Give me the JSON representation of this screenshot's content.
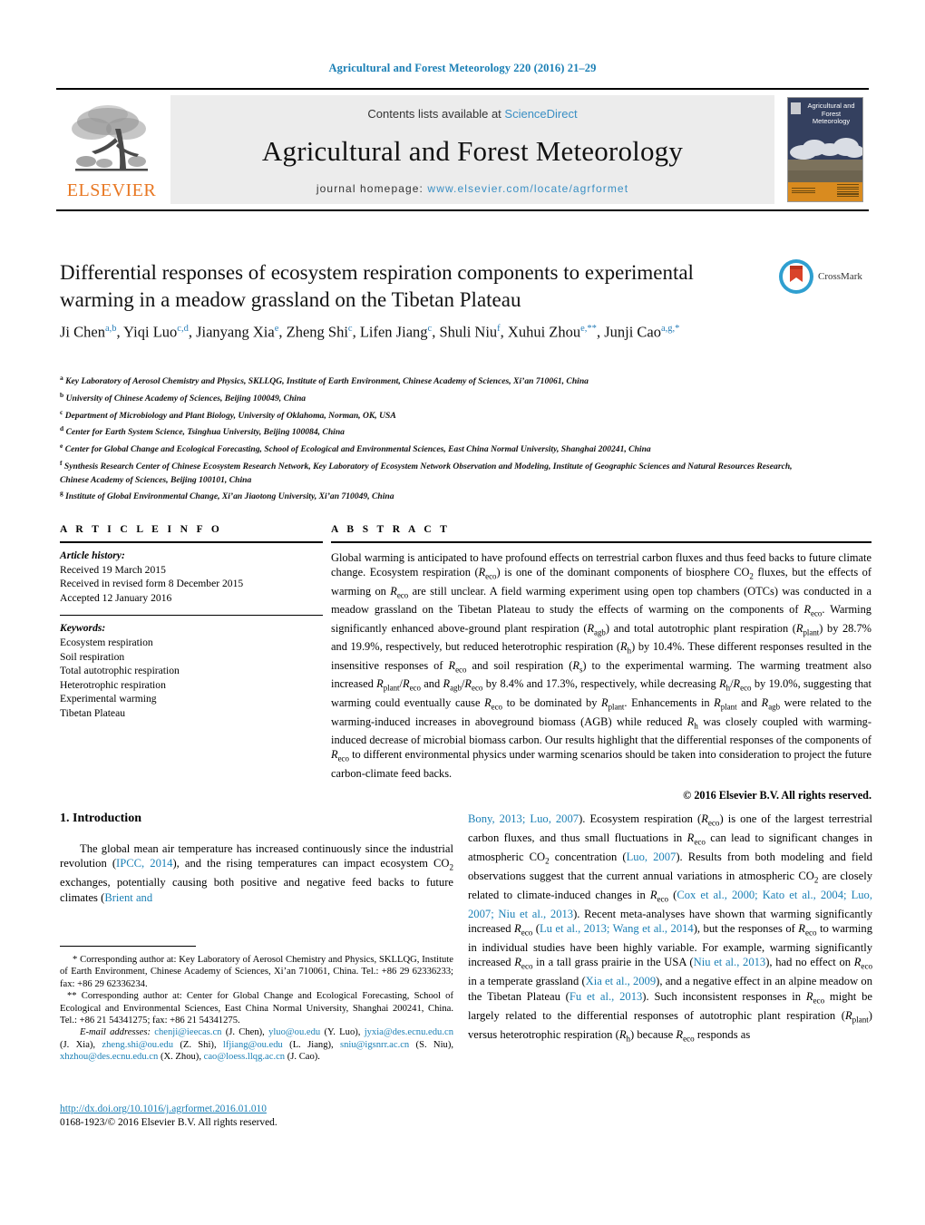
{
  "running_head": "Agricultural and Forest Meteorology 220 (2016) 21–29",
  "masthead": {
    "publisher": "ELSEVIER",
    "contents_prefix": "Contents lists available at ",
    "contents_link": "ScienceDirect",
    "journal_title": "Agricultural and Forest Meteorology",
    "homepage_prefix": "journal homepage: ",
    "homepage_url": "www.elsevier.com/locate/agrformet",
    "cover_title": "Agricultural and Forest Meteorology"
  },
  "article": {
    "title": "Differential responses of ecosystem respiration components to experimental warming in a meadow grassland on the Tibetan Plateau",
    "crossmark_label": "CrossMark",
    "authors_html": "Ji Chen<sup>a,b</sup>, Yiqi Luo<sup>c,d</sup>, Jianyang Xia<sup>e</sup>, Zheng Shi<sup>c</sup>, Lifen Jiang<sup>c</sup>, Shuli Niu<sup>f</sup>, Xuhui Zhou<sup>e,**</sup>, Junji Cao<sup>a,g,*</sup>",
    "affiliations": [
      {
        "mark": "a",
        "text": "Key Laboratory of Aerosol Chemistry and Physics, SKLLQG, Institute of Earth Environment, Chinese Academy of Sciences, Xi’an 710061, China"
      },
      {
        "mark": "b",
        "text": "University of Chinese Academy of Sciences, Beijing 100049, China"
      },
      {
        "mark": "c",
        "text": "Department of Microbiology and Plant Biology, University of Oklahoma, Norman, OK, USA"
      },
      {
        "mark": "d",
        "text": "Center for Earth System Science, Tsinghua University, Beijing 100084, China"
      },
      {
        "mark": "e",
        "text": "Center for Global Change and Ecological Forecasting, School of Ecological and Environmental Sciences, East China Normal University, Shanghai 200241, China"
      },
      {
        "mark": "f",
        "text": "Synthesis Research Center of Chinese Ecosystem Research Network, Key Laboratory of Ecosystem Network Observation and Modeling, Institute of Geographic Sciences and Natural Resources Research, Chinese Academy of Sciences, Beijing 100101, China"
      },
      {
        "mark": "g",
        "text": "Institute of Global Environmental Change, Xi’an Jiaotong University, Xi’an 710049, China"
      }
    ]
  },
  "info": {
    "heading": "A R T I C L E   I N F O",
    "history_label": "Article history:",
    "history": [
      "Received 19 March 2015",
      "Received in revised form 8 December 2015",
      "Accepted 12 January 2016"
    ],
    "keywords_label": "Keywords:",
    "keywords": [
      "Ecosystem respiration",
      "Soil respiration",
      "Total autotrophic respiration",
      "Heterotrophic respiration",
      "Experimental warming",
      "Tibetan Plateau"
    ]
  },
  "abstract": {
    "heading": "A B S T R A C T",
    "text_html": "Global warming is anticipated to have profound effects on terrestrial carbon fluxes and thus feed backs to future climate change. Ecosystem respiration (<i>R</i><sub>eco</sub>) is one of the dominant components of biosphere CO<sub>2</sub> fluxes, but the effects of warming on <i>R</i><sub>eco</sub> are still unclear. A field warming experiment using open top chambers (OTCs) was conducted in a meadow grassland on the Tibetan Plateau to study the effects of warming on the components of <i>R</i><sub>eco</sub>. Warming significantly enhanced above-ground plant respiration (<i>R</i><sub>agb</sub>) and total autotrophic plant respiration (<i>R</i><sub>plant</sub>) by 28.7% and 19.9%, respectively, but reduced heterotrophic respiration (<i>R</i><sub>h</sub>) by 10.4%. These different responses resulted in the insensitive responses of <i>R</i><sub>eco</sub> and soil respiration (<i>R</i><sub>s</sub>) to the experimental warming. The warming treatment also increased <i>R</i><sub>plant</sub>/<i>R</i><sub>eco</sub> and <i>R</i><sub>agb</sub>/<i>R</i><sub>eco</sub> by 8.4% and 17.3%, respectively, while decreasing <i>R</i><sub>h</sub>/<i>R</i><sub>eco</sub> by 19.0%, suggesting that warming could eventually cause <i>R</i><sub>eco</sub> to be dominated by <i>R</i><sub>plant</sub>. Enhancements in <i>R</i><sub>plant</sub> and <i>R</i><sub>agb</sub> were related to the warming-induced increases in aboveground biomass (AGB) while reduced <i>R</i><sub>h</sub> was closely coupled with warming-induced decrease of microbial biomass carbon. Our results highlight that the differential responses of the components of <i>R</i><sub>eco</sub> to different environmental physics under warming scenarios should be taken into consideration to project the future carbon-climate feed backs.",
    "copyright": "© 2016 Elsevier B.V. All rights reserved."
  },
  "body": {
    "section_number_title": "1.  Introduction",
    "left_para_html": "The global mean air temperature has increased continuously since the industrial revolution (<span class=\"lnk\">IPCC, 2014</span>), and the rising temperatures can impact ecosystem CO<sub>2</sub> exchanges, potentially causing both positive and negative feed backs to future climates (<span class=\"lnk\">Brient and</span>",
    "right_para_html": "<span class=\"lnk\">Bony, 2013; Luo, 2007</span>). Ecosystem respiration (<i>R</i><sub>eco</sub>) is one of the largest terrestrial carbon fluxes, and thus small fluctuations in <i>R</i><sub>eco</sub> can lead to significant changes in atmospheric CO<sub>2</sub> concentration (<span class=\"lnk\">Luo, 2007</span>). Results from both modeling and field observations suggest that the current annual variations in atmospheric CO<sub>2</sub> are closely related to climate-induced changes in <i>R</i><sub>eco</sub> (<span class=\"lnk\">Cox et al., 2000; Kato et al., 2004; Luo, 2007; Niu et al., 2013</span>). Recent meta-analyses have shown that warming significantly increased <i>R</i><sub>eco</sub> (<span class=\"lnk\">Lu et al., 2013; Wang et al., 2014</span>), but the responses of <i>R</i><sub>eco</sub> to warming in individual studies have been highly variable. For example, warming significantly increased <i>R</i><sub>eco</sub> in a tall grass prairie in the USA (<span class=\"lnk\">Niu et al., 2013</span>), had no effect on <i>R</i><sub>eco</sub> in a temperate grassland (<span class=\"lnk\">Xia et al., 2009</span>), and a negative effect in an alpine meadow on the Tibetan Plateau (<span class=\"lnk\">Fu et al., 2013</span>). Such inconsistent responses in <i>R</i><sub>eco</sub> might be largely related to the differential responses of autotrophic plant respiration (<i>R</i><sub>plant</sub>) versus heterotrophic respiration (<i>R</i><sub>h</sub>) because <i>R</i><sub>eco</sub> responds as"
  },
  "footnotes": {
    "corresponding_1_html": "* Corresponding author at: Key Laboratory of Aerosol Chemistry and Physics, SKLLQG, Institute of Earth Environment, Chinese Academy of Sciences, Xi’an 710061, China. Tel.: +86 29 62336233; fax: +86 29 62336234.",
    "corresponding_2_html": "** Corresponding author at: Center for Global Change and Ecological Forecasting, School of Ecological and Environmental Sciences, East China Normal University, Shanghai 200241, China. Tel.: +86 21 54341275; fax: +86 21 54341275.",
    "emails_label": "E-mail addresses:",
    "emails_html": "<span class=\"lnk\">chenji@ieecas.cn</span> (J. Chen), <span class=\"lnk\">yluo@ou.edu</span> (Y. Luo), <span class=\"lnk\">jyxia@des.ecnu.edu.cn</span> (J. Xia), <span class=\"lnk\">zheng.shi@ou.edu</span> (Z. Shi), <span class=\"lnk\">lfjiang@ou.edu</span> (L. Jiang), <span class=\"lnk\">sniu@igsnrr.ac.cn</span> (S. Niu), <span class=\"lnk\">xhzhou@des.ecnu.edu.cn</span> (X. Zhou), <span class=\"lnk\">cao@loess.llqg.ac.cn</span> (J. Cao)."
  },
  "doi_block": {
    "doi_url": "http://dx.doi.org/10.1016/j.agrformet.2016.01.010",
    "issn_line": "0168-1923/© 2016 Elsevier B.V. All rights reserved."
  },
  "colors": {
    "link": "#1a7fb5",
    "elsevier_orange": "#E87722",
    "masthead_grey": "#ececec"
  }
}
